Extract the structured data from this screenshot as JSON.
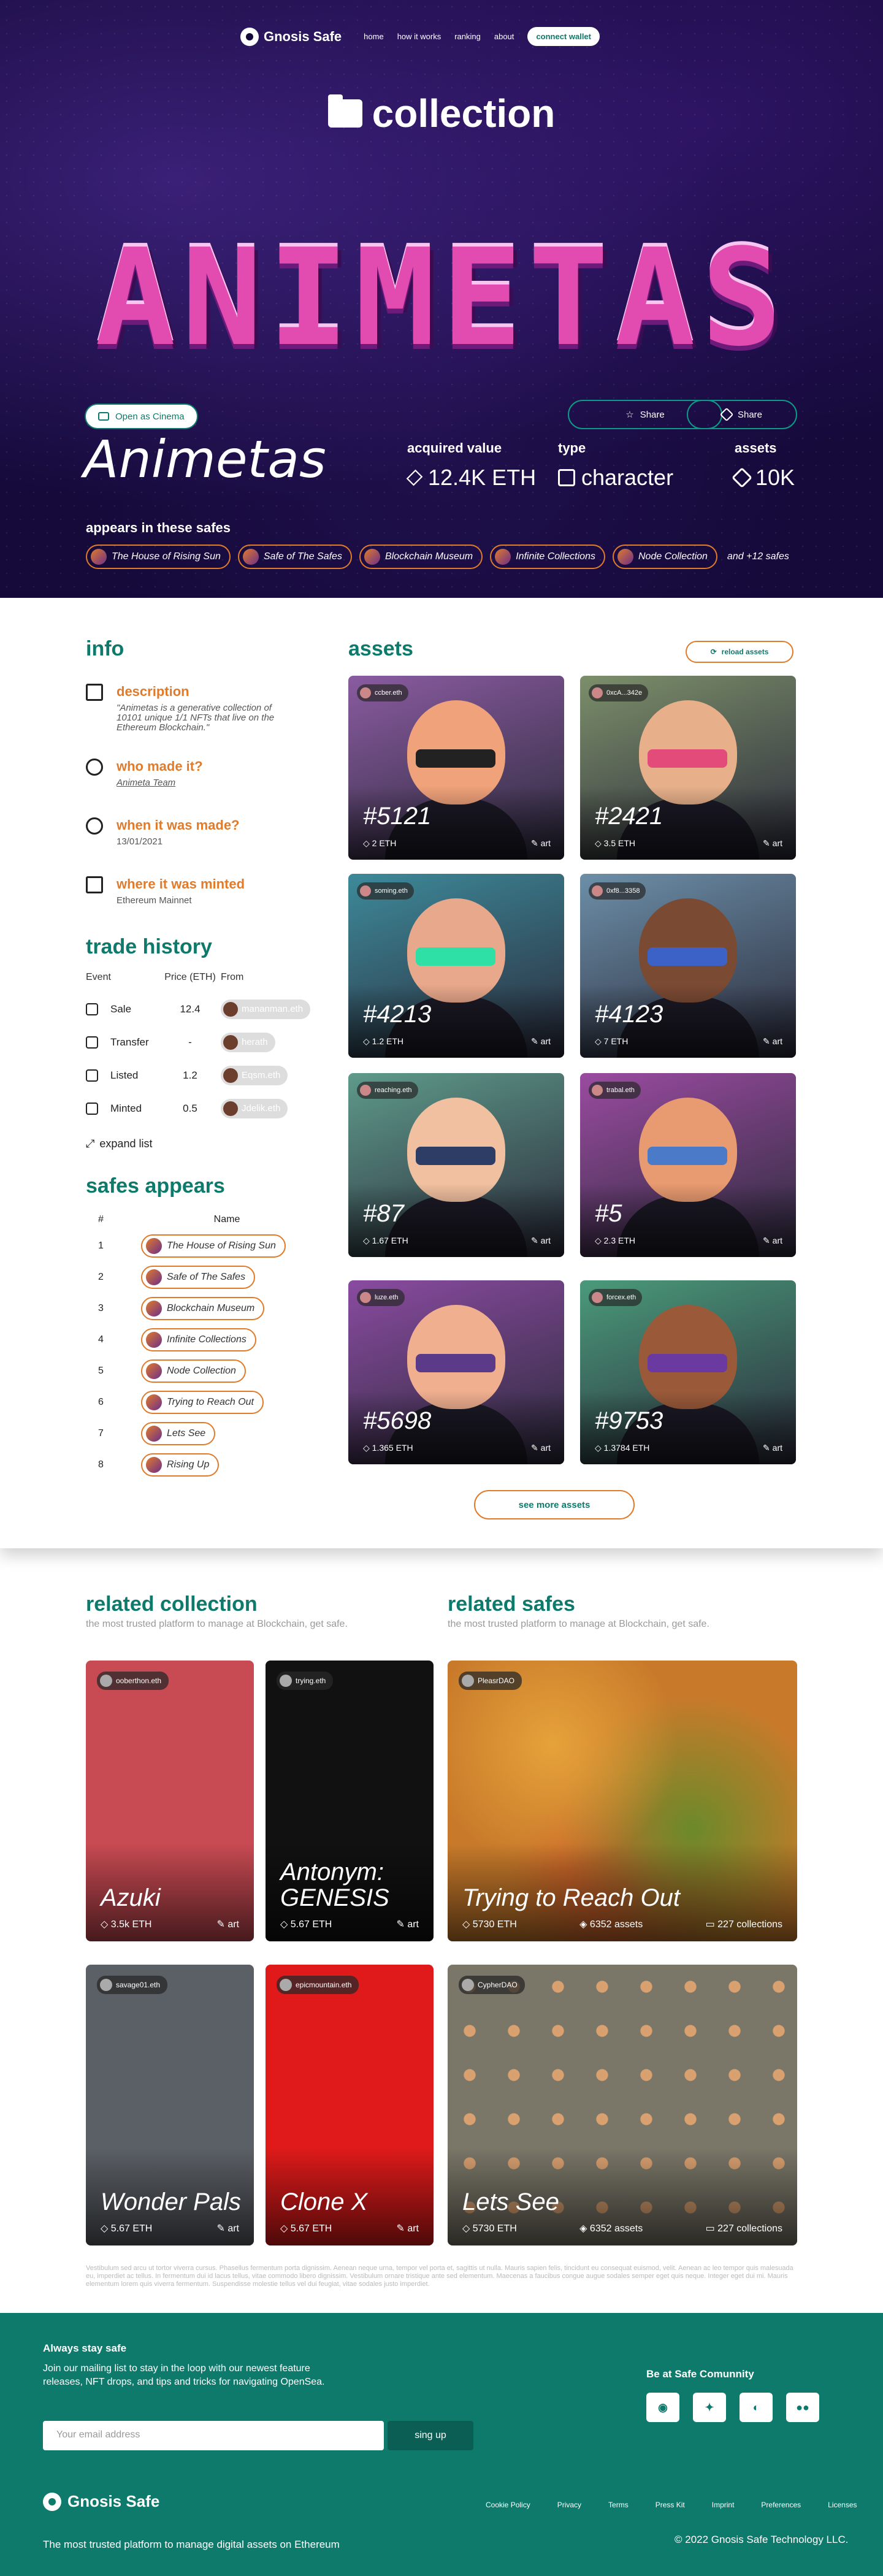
{
  "nav": {
    "brand": "Gnosis Safe",
    "links": [
      "home",
      "how it works",
      "ranking",
      "about"
    ],
    "wallet": "connect wallet"
  },
  "page_heading": "collection",
  "banner_text": "ANIMETAS",
  "hero": {
    "cinema": "Open as Cinema",
    "share1": "Share",
    "share2": "Share",
    "title": "Animetas",
    "stats": [
      {
        "label": "acquired value",
        "value": "12.4K ETH"
      },
      {
        "label": "type",
        "value": "character"
      },
      {
        "label": "assets",
        "value": "10K"
      }
    ],
    "appears_label": "appears in these safes",
    "chips": [
      "The House of Rising Sun",
      "Safe of The Safes",
      "Blockchain Museum",
      "Infinite Collections",
      "Node Collection"
    ],
    "more": "and +12 safes"
  },
  "info": {
    "title": "info",
    "items": [
      {
        "h": "description",
        "p": "\"Animetas is a generative collection of 10101 unique 1/1 NFTs that live on the Ethereum Blockchain.\""
      },
      {
        "h": "who made it?",
        "p": "Animeta Team"
      },
      {
        "h": "when it was made?",
        "p": "13/01/2021"
      },
      {
        "h": "where it was minted",
        "p": "Ethereum Mainnet"
      }
    ]
  },
  "trade": {
    "title": "trade history",
    "headers": [
      "Event",
      "Price (ETH)",
      "From"
    ],
    "rows": [
      {
        "event": "Sale",
        "price": "12.4",
        "from": "mananman.eth"
      },
      {
        "event": "Transfer",
        "price": "-",
        "from": "herath"
      },
      {
        "event": "Listed",
        "price": "1.2",
        "from": "Eqsm.eth"
      },
      {
        "event": "Minted",
        "price": "0.5",
        "from": "Jdelik.eth"
      }
    ],
    "expand": "expand list"
  },
  "safes": {
    "title": "safes appears",
    "headers": [
      "#",
      "Name"
    ],
    "rows": [
      {
        "n": "1",
        "name": "The House of Rising Sun"
      },
      {
        "n": "2",
        "name": "Safe of The Safes"
      },
      {
        "n": "3",
        "name": "Blockchain Museum"
      },
      {
        "n": "4",
        "name": "Infinite Collections"
      },
      {
        "n": "5",
        "name": "Node Collection"
      },
      {
        "n": "6",
        "name": "Trying to Reach Out"
      },
      {
        "n": "7",
        "name": "Lets See"
      },
      {
        "n": "8",
        "name": "Rising Up"
      }
    ]
  },
  "assets": {
    "title": "assets",
    "reload": "reload assets",
    "see_more": "see more assets",
    "cards": [
      {
        "owner": "ccber.eth",
        "num": "#5121",
        "eth": "2 ETH",
        "kind": "art",
        "bg": "#8a5ba0",
        "skin": "#f0a27a",
        "accent": "#222"
      },
      {
        "owner": "0xcA...342e",
        "num": "#2421",
        "eth": "3.5 ETH",
        "kind": "art",
        "bg": "#7c8f6a",
        "skin": "#e7b08a",
        "accent": "#e24b7a"
      },
      {
        "owner": "soming.eth",
        "num": "#4213",
        "eth": "1.2 ETH",
        "kind": "art",
        "bg": "#3d8a9a",
        "skin": "#e8a88b",
        "accent": "#2ee0a5"
      },
      {
        "owner": "0xf8...3358",
        "num": "#4123",
        "eth": "7 ETH",
        "kind": "art",
        "bg": "#6c8fa8",
        "skin": "#7b4a33",
        "accent": "#3c62c8"
      },
      {
        "owner": "reaching.eth",
        "num": "#87",
        "eth": "1.67 ETH",
        "kind": "art",
        "bg": "#5e9a8a",
        "skin": "#f0c0a0",
        "accent": "#2d3d66"
      },
      {
        "owner": "trabal.eth",
        "num": "#5",
        "eth": "2.3 ETH",
        "kind": "art",
        "bg": "#9a4ba0",
        "skin": "#e89a70",
        "accent": "#4a7ac8"
      },
      {
        "owner": "luze.eth",
        "num": "#5698",
        "eth": "1.365 ETH",
        "kind": "art",
        "bg": "#8a4ba0",
        "skin": "#f0b090",
        "accent": "#5b3a8a"
      },
      {
        "owner": "forcex.eth",
        "num": "#9753",
        "eth": "1.3784 ETH",
        "kind": "art",
        "bg": "#4a9a7a",
        "skin": "#9a5a3a",
        "accent": "#6b3aa0"
      }
    ]
  },
  "related": {
    "col_title": "related collection",
    "col_sub": "the most trusted platform to manage at Blockchain, get safe.",
    "safes_title": "related safes",
    "safes_sub": "the most trusted platform to manage at Blockchain, get safe.",
    "collections": [
      {
        "owner": "ooberthon.eth",
        "name": "Azuki",
        "eth": "3.5k ETH",
        "kind": "art",
        "bg": "#c84a52"
      },
      {
        "owner": "trying.eth",
        "name": "Antonym: GENESIS",
        "eth": "5.67 ETH",
        "kind": "art",
        "bg": "#111111"
      },
      {
        "owner": "savage01.eth",
        "name": "Wonder Pals",
        "eth": "5.67 ETH",
        "kind": "art",
        "bg": "#5b6066"
      },
      {
        "owner": "epicmountain.eth",
        "name": "Clone X",
        "eth": "5.67 ETH",
        "kind": "art",
        "bg": "#e01a1a"
      }
    ],
    "safes": [
      {
        "owner": "PleasrDAO",
        "name": "Trying to Reach Out",
        "eth": "5730 ETH",
        "assets": "6352 assets",
        "collections": "227 collections",
        "bg": "#c87a2a"
      },
      {
        "owner": "CypherDAO",
        "name": "Lets See",
        "eth": "5730 ETH",
        "assets": "6352 assets",
        "collections": "227 collections",
        "bg": "#7a7668"
      }
    ]
  },
  "disclaimer": "Vestibulum sed arcu ut tortor viverra cursus. Phasellus fermentum porta dignissim. Aenean neque urna, tempor vel porta et, sagittis ut nulla. Mauris sapien felis, tincidunt eu consequat euismod, velit. Aenean ac leo tempor quis malesuada eu, imperdiet ac tellus. In fermentum dui id lacus tellus, vitae commodo libero dignissim. Vestibulum ornare tristique ante sed elementum. Maecenas a faucibus congue augue sodales semper eget quis neque. Integer eget dui mi. Mauris elementum lorem quis viverra fermentum. Suspendisse molestie tellus vel dui feugiat, vitae sodales justo imperdiet.",
  "footer": {
    "h": "Always stay safe",
    "p": "Join our mailing list to stay in the loop with our newest feature releases, NFT drops, and tips and tricks for navigating OpenSea.",
    "email_placeholder": "Your email address",
    "signup": "sing up",
    "community": "Be at Safe Comunnity",
    "brand": "Gnosis Safe",
    "links": [
      "Cookie Policy",
      "Privacy",
      "Terms",
      "Press Kit",
      "Imprint",
      "Preferences",
      "Licenses"
    ],
    "tagline": "The most trusted platform to manage digital assets on Ethereum",
    "copyright": "© 2022 Gnosis Safe Technology LLC."
  }
}
